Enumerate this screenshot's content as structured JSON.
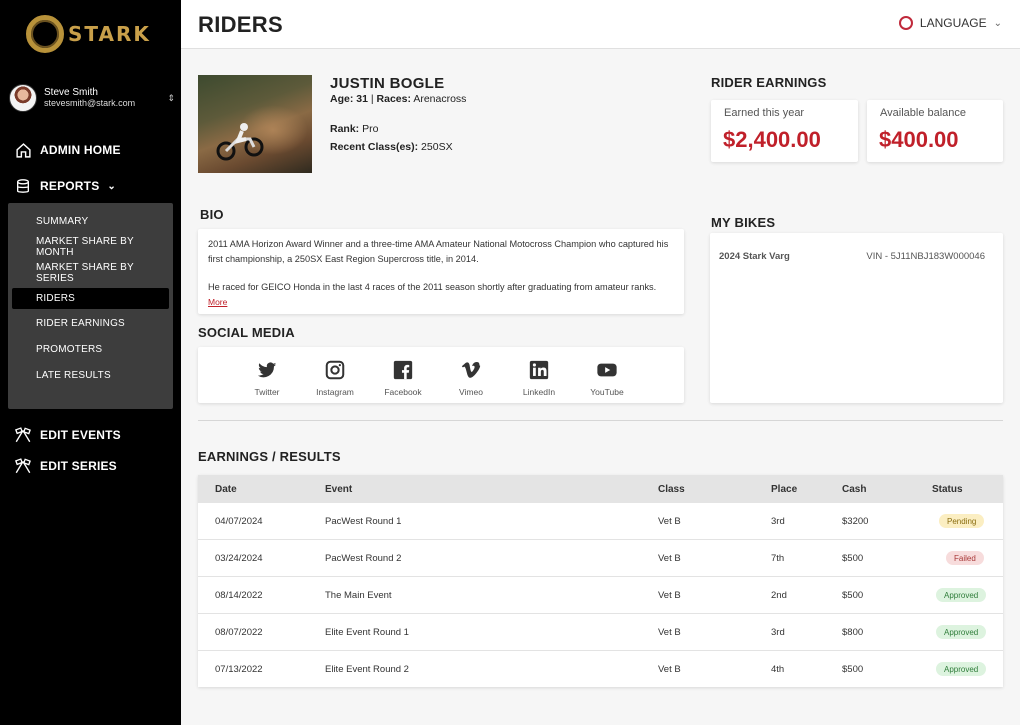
{
  "brand": {
    "name": "STARK"
  },
  "user": {
    "name": "Steve Smith",
    "email": "stevesmith@stark.com"
  },
  "nav": {
    "admin_home": "ADMIN HOME",
    "reports": "REPORTS",
    "reports_items": [
      "SUMMARY",
      "MARKET SHARE BY MONTH",
      "MARKET SHARE BY SERIES",
      "RIDERS",
      "RIDER EARNINGS",
      "PROMOTERS",
      "LATE RESULTS"
    ],
    "active_item": "RIDERS",
    "edit_events": "EDIT EVENTS",
    "edit_series": "EDIT SERIES"
  },
  "header": {
    "title": "RIDERS",
    "language": "LANGUAGE"
  },
  "rider": {
    "name": "JUSTIN BOGLE",
    "age_label": "Age:",
    "age": "31",
    "races_label": "Races:",
    "races": "Arenacross",
    "rank_label": "Rank:",
    "rank": "Pro",
    "classes_label": "Recent Class(es):",
    "classes": "250SX"
  },
  "earnings": {
    "title": "RIDER EARNINGS",
    "earned_label": "Earned this year",
    "earned_value": "$2,400.00",
    "balance_label": "Available balance",
    "balance_value": "$400.00"
  },
  "bio": {
    "title": "BIO",
    "p1": "2011 AMA Horizon Award Winner and a three-time AMA Amateur National Motocross Champion who captured his first championship, a 250SX East Region Supercross title, in 2014.",
    "p2": "He raced for GEICO Honda in the last 4 races of the 2011 season shortly after graduating from amateur ranks.",
    "more": "More"
  },
  "social": {
    "title": "SOCIAL MEDIA",
    "items": [
      "Twitter",
      "Instagram",
      "Facebook",
      "Vimeo",
      "LinkedIn",
      "YouTube"
    ]
  },
  "bikes": {
    "title": "MY BIKES",
    "items": [
      {
        "name": "2024 Stark Varg",
        "vin": "VIN - 5J11NBJ183W000046"
      }
    ]
  },
  "results": {
    "title": "EARNINGS / RESULTS",
    "columns": [
      "Date",
      "Event",
      "Class",
      "Place",
      "Cash",
      "Status"
    ],
    "rows": [
      {
        "date": "04/07/2024",
        "event": "PacWest Round 1",
        "class": "Vet B",
        "place": "3rd",
        "cash": "$3200",
        "status": "Pending"
      },
      {
        "date": "03/24/2024",
        "event": "PacWest Round 2",
        "class": "Vet B",
        "place": "7th",
        "cash": "$500",
        "status": "Failed"
      },
      {
        "date": "08/14/2022",
        "event": "The Main Event",
        "class": "Vet B",
        "place": "2nd",
        "cash": "$500",
        "status": "Approved"
      },
      {
        "date": "08/07/2022",
        "event": "Elite Event Round 1",
        "class": "Vet B",
        "place": "3rd",
        "cash": "$800",
        "status": "Approved"
      },
      {
        "date": "07/13/2022",
        "event": "Elite Event Round 2",
        "class": "Vet B",
        "place": "4th",
        "cash": "$500",
        "status": "Approved"
      }
    ]
  },
  "colors": {
    "accent": "#c0202a",
    "pending_bg": "#fbeec2",
    "failed_bg": "#f7dcdc",
    "approved_bg": "#ddf3df"
  }
}
